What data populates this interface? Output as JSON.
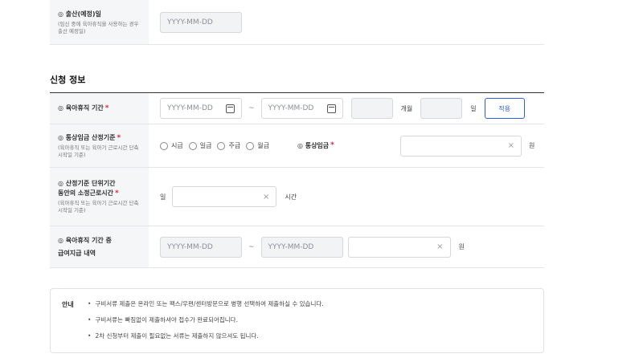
{
  "birth_row": {
    "label": "◎ 출산(예정)일",
    "sub": "(임신 중에 육아휴직을 사용하는 경우 출산 예정일)",
    "date_placeholder": "YYYY-MM-DD"
  },
  "section_title": "신청 정보",
  "leave_period": {
    "label": "◎ 육아휴직 기간",
    "required_mark": "*",
    "start_placeholder": "YYYY-MM-DD",
    "end_placeholder": "YYYY-MM-DD",
    "separator": "~",
    "months_unit": "개월",
    "days_unit": "일",
    "apply_button": "적용",
    "calendar_icon": "calendar-icon"
  },
  "wage_basis": {
    "label": "◎ 통상임금 산정기준",
    "required_mark": "*",
    "sub": "(육아휴직 또는 육아기 근로시간 단축 시작일 기준)",
    "options": [
      "시급",
      "일급",
      "주급",
      "월급"
    ],
    "wage_label": "◎ 통상임금",
    "wage_required_mark": "*",
    "clear_icon": "×",
    "currency_unit": "원"
  },
  "work_hours": {
    "label_line1": "◎ 산정기준 단위기간",
    "label_line2": "동안의 소정근로시간",
    "required_mark": "*",
    "sub": "(육아휴직 또는 육아기 근로시간 단축 시작일 기준)",
    "prefix": "일",
    "clear_icon": "×",
    "unit": "시간"
  },
  "pay_history": {
    "label_line1": "◎ 육아휴직 기간 중",
    "label_line2": "급여지급 내역",
    "start_placeholder": "YYYY-MM-DD",
    "end_placeholder": "YYYY-MM-DD",
    "separator": "~",
    "clear_icon": "×",
    "currency_unit": "원"
  },
  "notice": {
    "title": "안내",
    "items": [
      "구비서류 제출은 온라인 또는 팩스/우편/센터방문으로 병행 선택하여 제출하실 수 있습니다.",
      "구비서류는 빠짐없이 제출하셔야 접수가 완료되어집니다.",
      "2차 신청부터 제출이 필요없는 서류는 제출하지 않으셔도 됩니다."
    ]
  }
}
